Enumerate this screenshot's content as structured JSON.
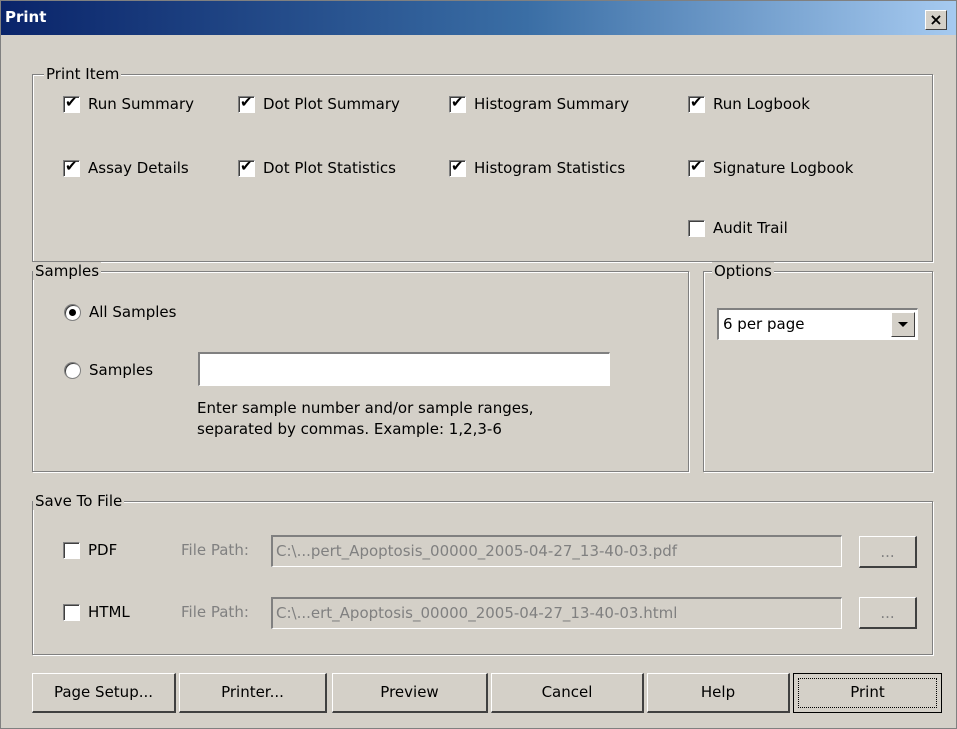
{
  "window": {
    "title": "Print",
    "close": "×"
  },
  "print_item": {
    "legend": "Print Item",
    "items": [
      {
        "label": "Run Summary",
        "checked": true
      },
      {
        "label": "Dot Plot Summary",
        "checked": true
      },
      {
        "label": "Histogram Summary",
        "checked": true
      },
      {
        "label": "Run Logbook",
        "checked": true
      },
      {
        "label": "Assay Details",
        "checked": true
      },
      {
        "label": "Dot Plot Statistics",
        "checked": true
      },
      {
        "label": "Histogram Statistics",
        "checked": true
      },
      {
        "label": "Signature Logbook",
        "checked": true
      },
      {
        "label": "Audit Trail",
        "checked": false
      }
    ],
    "tick": "✔"
  },
  "samples": {
    "legend": "Samples",
    "all_label": "All Samples",
    "some_label": "Samples",
    "input_value": "",
    "hint_line1": "Enter sample number and/or sample ranges,",
    "hint_line2": "separated by commas. Example: 1,2,3-6"
  },
  "options": {
    "legend": "Options",
    "selected": "6 per page"
  },
  "save_to_file": {
    "legend": "Save To File",
    "pdf_label": "PDF",
    "html_label": "HTML",
    "file_path_label": "File Path:",
    "pdf_path": "C:\\...pert_Apoptosis_00000_2005-04-27_13-40-03.pdf",
    "html_path": "C:\\...ert_Apoptosis_00000_2005-04-27_13-40-03.html",
    "browse": "..."
  },
  "buttons": {
    "page_setup": "Page Setup...",
    "printer": "Printer...",
    "preview": "Preview",
    "cancel": "Cancel",
    "help": "Help",
    "print": "Print"
  }
}
